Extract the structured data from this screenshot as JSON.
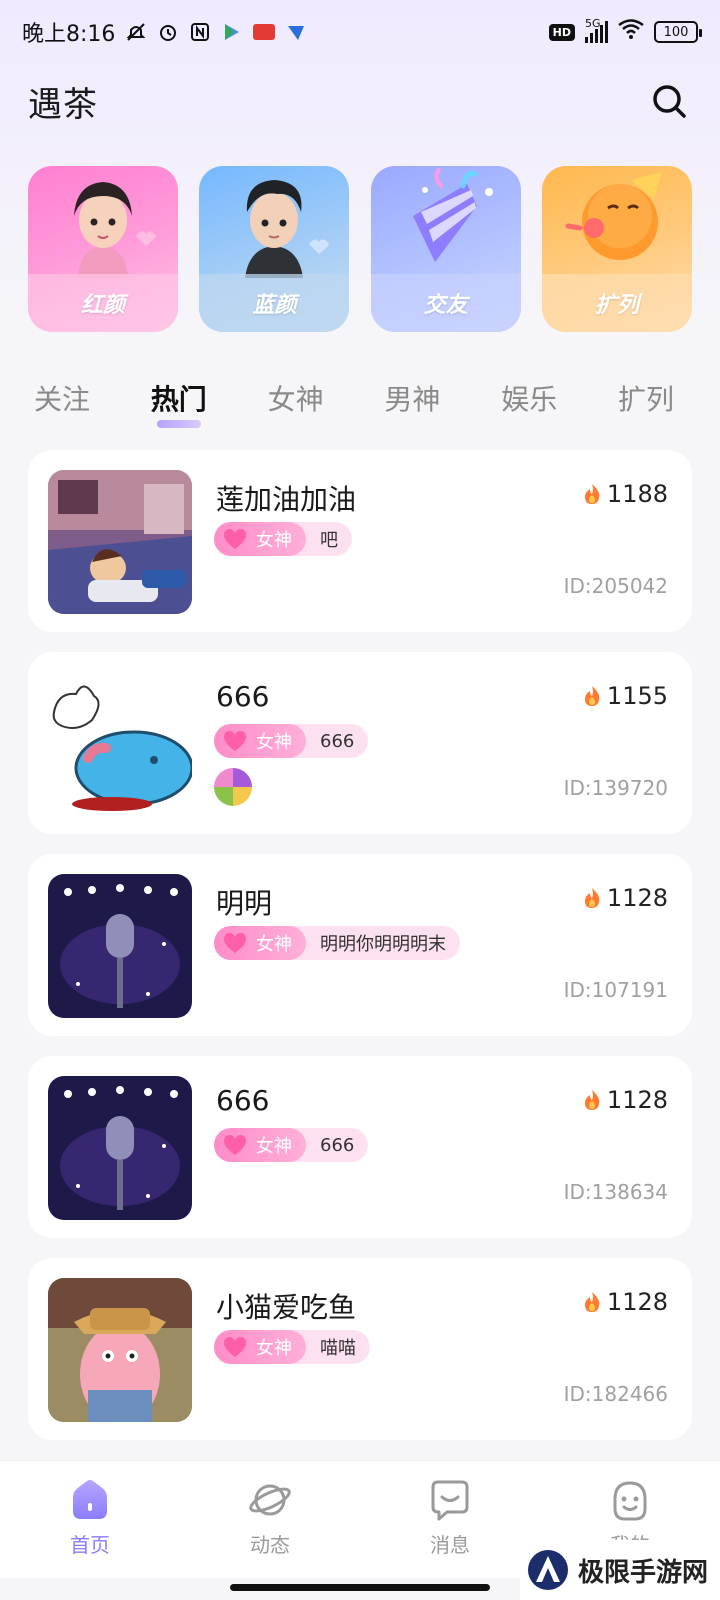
{
  "status_bar": {
    "time": "晚上8:16",
    "network": "5G",
    "hd": "HD",
    "battery": "100"
  },
  "header": {
    "title": "遇茶",
    "search_icon": "search-icon"
  },
  "categories": [
    {
      "label": "红颜",
      "color": "#ff8ad3"
    },
    {
      "label": "蓝颜",
      "color": "#8fc3ff"
    },
    {
      "label": "交友",
      "color": "#a9b6ff"
    },
    {
      "label": "扩列",
      "color": "#ffc070"
    }
  ],
  "tabs": [
    {
      "label": "关注",
      "active": false
    },
    {
      "label": "热门",
      "active": true
    },
    {
      "label": "女神",
      "active": false
    },
    {
      "label": "男神",
      "active": false
    },
    {
      "label": "娱乐",
      "active": false
    },
    {
      "label": "扩列",
      "active": false
    }
  ],
  "rooms": [
    {
      "name": "莲加油加油",
      "heat": "1188",
      "tag": "女神",
      "sub": "吧",
      "id": "ID:205042",
      "thumb": "room-cartoon-boy"
    },
    {
      "name": "666",
      "heat": "1155",
      "tag": "女神",
      "sub": "666",
      "id": "ID:139720",
      "thumb": "blue-cat-sticker"
    },
    {
      "name": "明明",
      "heat": "1128",
      "tag": "女神",
      "sub": "明明你明明明末",
      "id": "ID:107191",
      "thumb": "stage-microphone"
    },
    {
      "name": "666",
      "heat": "1128",
      "tag": "女神",
      "sub": "666",
      "id": "ID:138634",
      "thumb": "stage-microphone"
    },
    {
      "name": "小猫爱吃鱼",
      "heat": "1128",
      "tag": "女神",
      "sub": "喵喵",
      "id": "ID:182466",
      "thumb": "cartoon-starfish-cowboy"
    }
  ],
  "bottom_nav": [
    {
      "label": "首页",
      "icon": "home-icon",
      "active": true
    },
    {
      "label": "动态",
      "icon": "planet-icon",
      "active": false
    },
    {
      "label": "消息",
      "icon": "message-icon",
      "active": false
    },
    {
      "label": "我的",
      "icon": "profile-icon",
      "active": false
    }
  ],
  "watermark": "极限手游网",
  "colors": {
    "accent": "#8a7cff",
    "tag_pink": "#ff8cc8",
    "heat_flame": "#ff7a2f"
  }
}
